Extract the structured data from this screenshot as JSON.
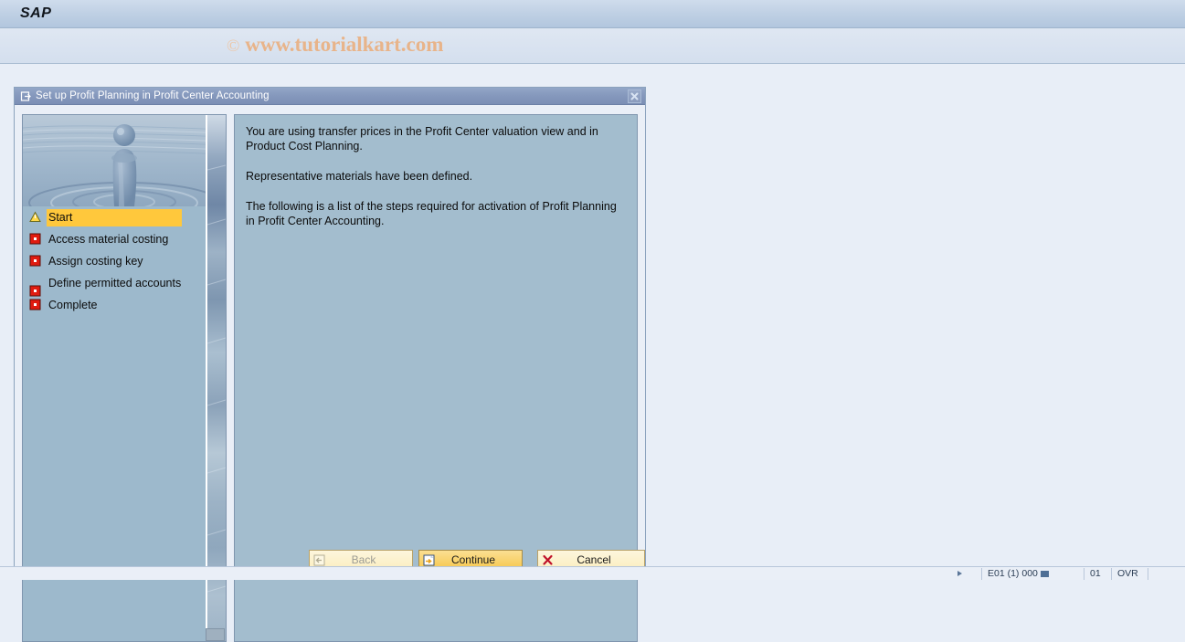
{
  "app": {
    "logo": "SAP",
    "watermark_copyright": "©",
    "watermark_text": "www.tutorialkart.com"
  },
  "dialog": {
    "title": "Set up Profit Planning in Profit Center Accounting",
    "close_label": "×",
    "steps": [
      {
        "label": "Start",
        "icon": "warning-triangle-icon",
        "state": "active"
      },
      {
        "label": "Access material costing",
        "icon": "red-square-icon",
        "state": "pending"
      },
      {
        "label": "Assign costing key",
        "icon": "red-square-icon",
        "state": "pending"
      },
      {
        "label": "Define permitted accounts",
        "icon": "red-square-icon",
        "state": "pending"
      },
      {
        "label": "Complete",
        "icon": "red-square-icon",
        "state": "pending"
      }
    ],
    "paragraphs": [
      "You are using transfer prices in the Profit Center valuation view and in Product Cost Planning.",
      "Representative materials have been defined.",
      "The following is a list of the steps required for activation of Profit Planning in Profit Center Accounting."
    ],
    "buttons": {
      "back": {
        "label": "Back",
        "icon": "back-arrow-icon",
        "enabled": false
      },
      "continue": {
        "label": "Continue",
        "icon": "continue-arrow-icon",
        "enabled": true
      },
      "cancel": {
        "label": "Cancel",
        "icon": "red-x-icon",
        "enabled": true
      }
    }
  },
  "statusbar": {
    "system": "E01 (1) 000",
    "instance": "01",
    "insert_mode": "OVR"
  },
  "colors": {
    "accent_highlight": "#ffc83c",
    "pane_background": "#a3bdce",
    "dialog_titlebar": "#8699bd",
    "watermark": "#e8b48a"
  }
}
